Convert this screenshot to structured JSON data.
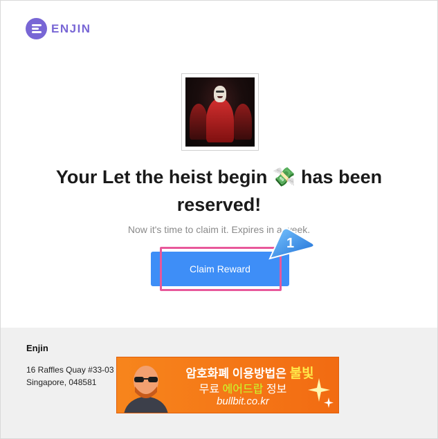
{
  "brand": {
    "name": "ENJIN",
    "color": "#7866d5"
  },
  "nft": {
    "image_icon": "nft-artwork"
  },
  "heading": {
    "text": "Your Let the heist begin 💸 has been reserved!"
  },
  "subtitle": {
    "text": "Now it's time to claim it. Expires in a week."
  },
  "cta": {
    "label": "Claim Reward",
    "color": "#3e8ef7"
  },
  "annotation": {
    "marker_number": "1",
    "highlight_color": "#e8589a"
  },
  "footer": {
    "company": "Enjin",
    "address_line1": "16 Raffles Quay #33-03",
    "address_line2": "Singapore, 048581"
  },
  "ad": {
    "line1_prefix": "암호화폐 이용방법은 ",
    "line1_accent": "불빛",
    "line2_prefix": "무료 ",
    "line2_accent": "에어드랍",
    "line2_suffix": " 정보",
    "line3": "bullbit.co.kr",
    "colors": {
      "background": "#f7851c",
      "accent_yellow": "#ffe94a",
      "accent_green": "#c7ff2e"
    }
  }
}
